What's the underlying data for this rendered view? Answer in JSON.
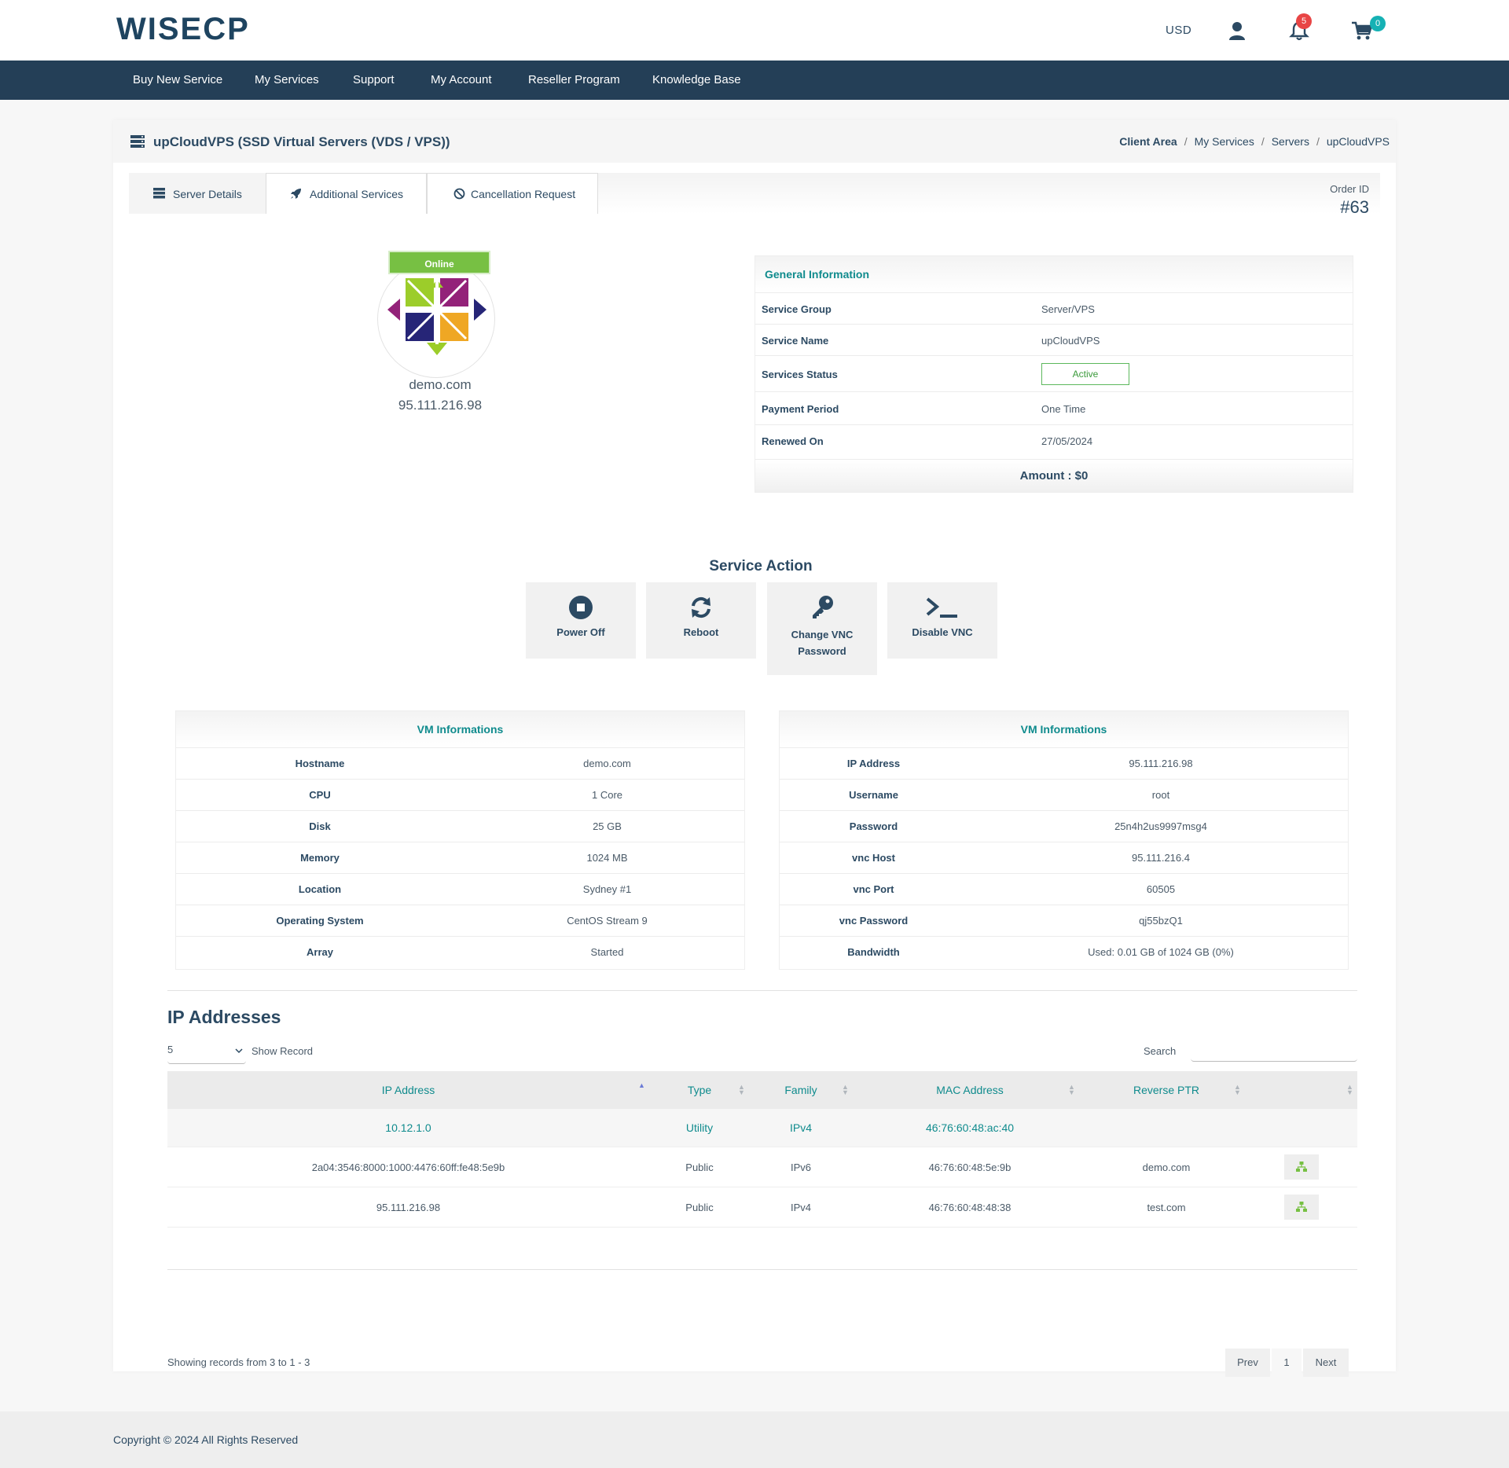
{
  "header": {
    "brand": "WISECP",
    "currency": "USD",
    "notifications_count": "5",
    "cart_count": "0",
    "colors": {
      "navbar": "#243f57",
      "accent": "#0f8b8d",
      "badge_red": "#e84545",
      "badge_teal": "#16b1b4"
    }
  },
  "nav": {
    "items": [
      "Buy New Service",
      "My Services",
      "Support",
      "My Account",
      "Reseller Program",
      "Knowledge Base"
    ]
  },
  "page": {
    "title": "upCloudVPS (SSD Virtual Servers (VDS / VPS))",
    "breadcrumb": [
      "Client Area",
      "My Services",
      "Servers",
      "upCloudVPS"
    ],
    "breadcrumb_sep": "/",
    "order_id_label": "Order ID",
    "order_id": "#63"
  },
  "tabs": [
    {
      "label": "Server Details",
      "icon": "server-list-icon"
    },
    {
      "label": "Additional Services",
      "icon": "rocket-icon"
    },
    {
      "label": "Cancellation Request",
      "icon": "ban-icon"
    }
  ],
  "server": {
    "status": "Online",
    "os_icon": "centos-logo",
    "hostname": "demo.com",
    "ip": "95.111.216.98"
  },
  "general": {
    "title": "General Information",
    "rows": [
      {
        "label": "Service Group",
        "value": "Server/VPS"
      },
      {
        "label": "Service Name",
        "value": "upCloudVPS"
      },
      {
        "label": "Services Status",
        "value": "Active"
      },
      {
        "label": "Payment Period",
        "value": "One Time"
      },
      {
        "label": "Renewed On",
        "value": "27/05/2024"
      }
    ],
    "amount": "Amount : $0"
  },
  "actions": {
    "title": "Service Action",
    "buttons": [
      {
        "label": "Power Off",
        "icon": "stop-circle-icon"
      },
      {
        "label": "Reboot",
        "icon": "refresh-icon"
      },
      {
        "label": "Change VNC Password",
        "icon": "key-icon"
      },
      {
        "label": "Disable VNC",
        "icon": "terminal-icon"
      }
    ]
  },
  "vm_left": {
    "title": "VM Informations",
    "rows": [
      {
        "label": "Hostname",
        "value": "demo.com"
      },
      {
        "label": "CPU",
        "value": "1 Core"
      },
      {
        "label": "Disk",
        "value": "25 GB"
      },
      {
        "label": "Memory",
        "value": "1024 MB"
      },
      {
        "label": "Location",
        "value": "Sydney #1"
      },
      {
        "label": "Operating System",
        "value": "CentOS Stream 9"
      },
      {
        "label": "Array",
        "value": "Started"
      }
    ]
  },
  "vm_right": {
    "title": "VM Informations",
    "rows": [
      {
        "label": "IP Address",
        "value": "95.111.216.98"
      },
      {
        "label": "Username",
        "value": "root"
      },
      {
        "label": "Password",
        "value": "25n4h2us9997msg4"
      },
      {
        "label": "vnc Host",
        "value": "95.111.216.4"
      },
      {
        "label": "vnc Port",
        "value": "60505"
      },
      {
        "label": "vnc Password",
        "value": "qj55bzQ1"
      },
      {
        "label": "Bandwidth",
        "value": "Used: 0.01 GB of 1024 GB (0%)"
      }
    ]
  },
  "ips": {
    "title": "IP Addresses",
    "page_size": "5",
    "show_record_label": "Show Record",
    "search_label": "Search",
    "search_placeholder": "",
    "columns": [
      "IP Address",
      "Type",
      "Family",
      "MAC Address",
      "Reverse PTR",
      ""
    ],
    "rows": [
      {
        "ip": "10.12.1.0",
        "type": "Utility",
        "family": "IPv4",
        "mac": "46:76:60:48:ac:40",
        "ptr": ""
      },
      {
        "ip": "2a04:3546:8000:1000:4476:60ff:fe48:5e9b",
        "type": "Public",
        "family": "IPv6",
        "mac": "46:76:60:48:5e:9b",
        "ptr": "demo.com"
      },
      {
        "ip": "95.111.216.98",
        "type": "Public",
        "family": "IPv4",
        "mac": "46:76:60:48:48:38",
        "ptr": "test.com"
      }
    ],
    "showing": "Showing records from 3 to 1 - 3",
    "pager": {
      "prev": "Prev",
      "page": "1",
      "next": "Next"
    }
  },
  "footer": {
    "copyright": "Copyright © 2024 All Rights Reserved"
  }
}
